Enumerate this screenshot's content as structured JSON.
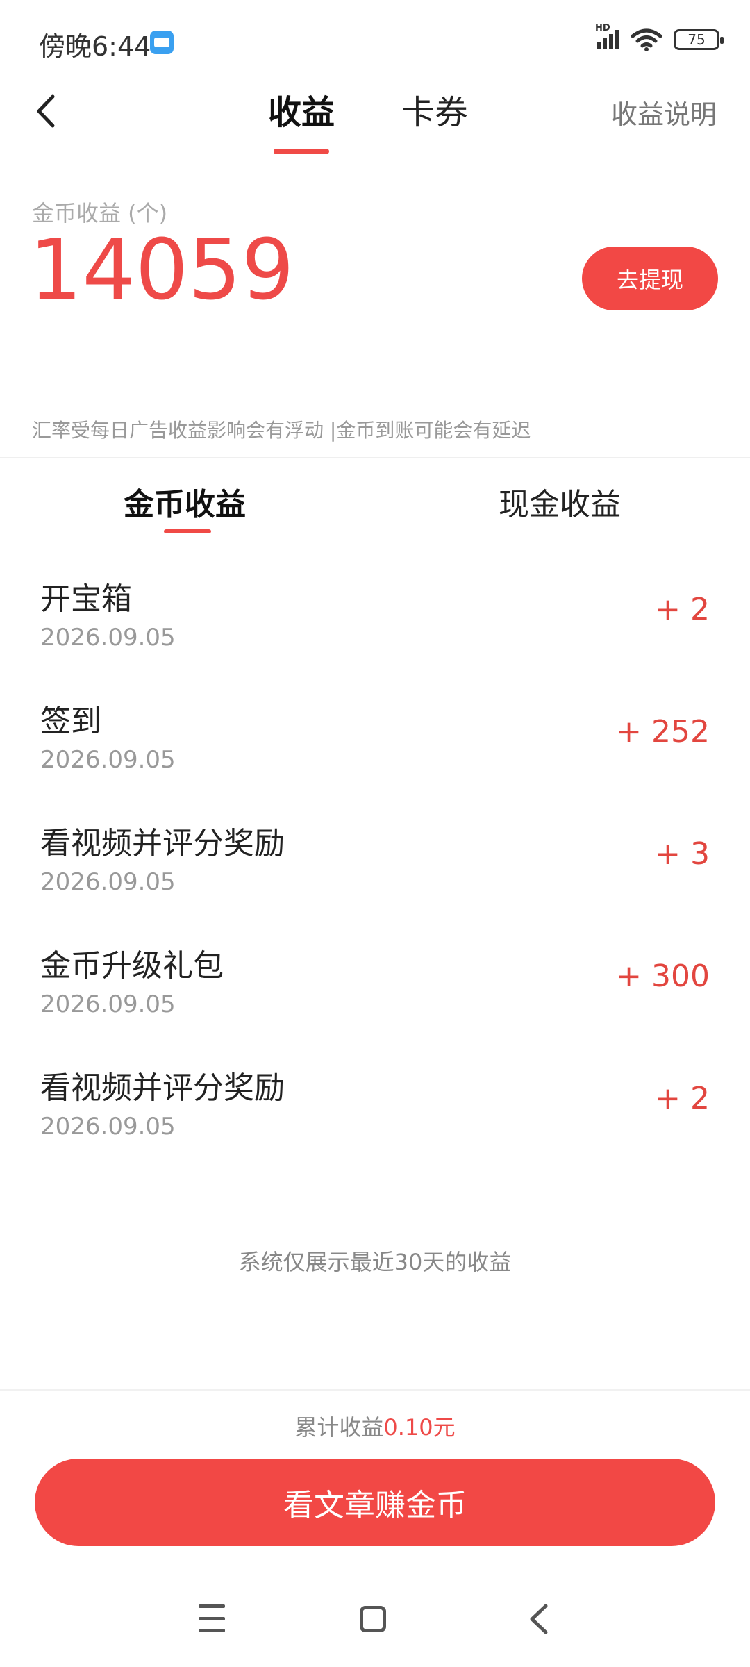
{
  "status_bar": {
    "time": "傍晚6:44",
    "network": "HD",
    "battery": "75"
  },
  "header": {
    "tabs": [
      {
        "label": "收益",
        "active": true
      },
      {
        "label": "卡券",
        "active": false
      }
    ],
    "explain_link": "收益说明"
  },
  "summary": {
    "coin_label": "金币收益 (个)",
    "coin_amount": "14059",
    "withdraw_label": "去提现",
    "rate_note": "汇率受每日广告收益影响会有浮动 |金币到账可能会有延迟"
  },
  "sub_tabs": [
    {
      "label": "金币收益",
      "active": true
    },
    {
      "label": "现金收益",
      "active": false
    }
  ],
  "records": [
    {
      "title": "开宝箱",
      "date": "2026.09.05",
      "amount": "+ 2"
    },
    {
      "title": "签到",
      "date": "2026.09.05",
      "amount": "+ 252"
    },
    {
      "title": "看视频并评分奖励",
      "date": "2026.09.05",
      "amount": "+ 3"
    },
    {
      "title": "金币升级礼包",
      "date": "2026.09.05",
      "amount": "+ 300"
    },
    {
      "title": "看视频并评分奖励",
      "date": "2026.09.05",
      "amount": "+ 2"
    }
  ],
  "list_footnote": "系统仅展示最近30天的收益",
  "footer": {
    "total_label": "累计收益",
    "total_value": "0.10元",
    "read_button": "看文章赚金币"
  },
  "colors": {
    "accent": "#f24845",
    "amount_text": "#e2463f"
  }
}
